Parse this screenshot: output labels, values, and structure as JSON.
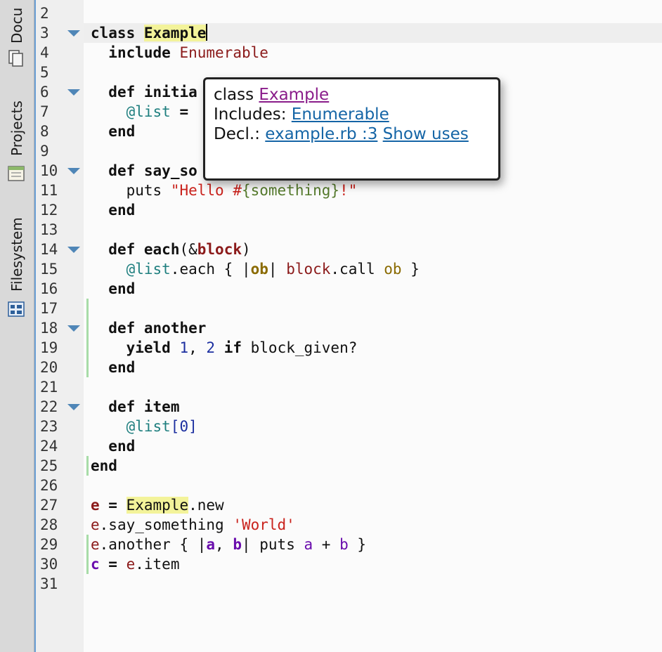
{
  "sidebar": {
    "tabs": [
      {
        "label": "Docu",
        "icon": "documents-icon"
      },
      {
        "label": "Projects",
        "icon": "projects-icon"
      },
      {
        "label": "Filesystem",
        "icon": "filesystem-icon"
      }
    ]
  },
  "gutter": {
    "line_numbers": [
      "2",
      "3",
      "4",
      "5",
      "6",
      "7",
      "8",
      "9",
      "10",
      "11",
      "12",
      "13",
      "14",
      "15",
      "16",
      "17",
      "18",
      "19",
      "20",
      "21",
      "22",
      "23",
      "24",
      "25",
      "26",
      "27",
      "28",
      "29",
      "30",
      "31"
    ]
  },
  "code": {
    "l2": "",
    "l3": {
      "kw": "class",
      "name": "Example"
    },
    "l4": {
      "kw": "include",
      "name": "Enumerable"
    },
    "l6": {
      "kw": "def",
      "name": "initia"
    },
    "l7": {
      "ivar": "@list",
      "op": "="
    },
    "l8": "end",
    "l10": {
      "kw": "def",
      "name": "say_so"
    },
    "l11": {
      "meth": "puts",
      "s1": "\"Hello #",
      "s2": "{something}",
      "s3": "!\""
    },
    "l12": "end",
    "l14": {
      "kw": "def",
      "name": "each",
      "p1": "(&",
      "arg": "block",
      "p2": ")"
    },
    "l15": {
      "ivar": "@list",
      "m1": ".each { |",
      "ob": "ob",
      "m2": "| ",
      "blk": "block",
      "m3": ".call ",
      "ob2": "ob",
      "m4": " }"
    },
    "l16": "end",
    "l18": {
      "kw": "def",
      "name": "another"
    },
    "l19": {
      "kw": "yield",
      "n1": "1",
      "c1": ", ",
      "n2": "2",
      "kw2": " if",
      "rest": " block_given?"
    },
    "l20": "end",
    "l22": {
      "kw": "def",
      "name": "item"
    },
    "l23": {
      "ivar": "@list",
      "b1": "[",
      "n": "0",
      "b2": "]"
    },
    "l24": "end",
    "l25": "end",
    "l27": {
      "v": "e",
      "op": " = ",
      "cls": "Example",
      "rest": ".new"
    },
    "l28": {
      "v": "e",
      "m": ".say_something ",
      "s": "'World'"
    },
    "l29": {
      "v": "e",
      "m": ".another { |",
      "a": "a",
      "c": ", ",
      "b": "b",
      "r": "| puts ",
      "a2": "a",
      "plus": " + ",
      "b2": "b",
      "end": " }"
    },
    "l30": {
      "v": "c",
      "op": " = ",
      "e": "e",
      "m": ".item"
    }
  },
  "popup": {
    "line1_prefix": "class ",
    "line1_link": "Example",
    "line2_prefix": "Includes: ",
    "line2_link": "Enumerable",
    "line3_prefix": "Decl.: ",
    "line3_link": "example.rb :3",
    "line3_link2": "Show uses"
  }
}
